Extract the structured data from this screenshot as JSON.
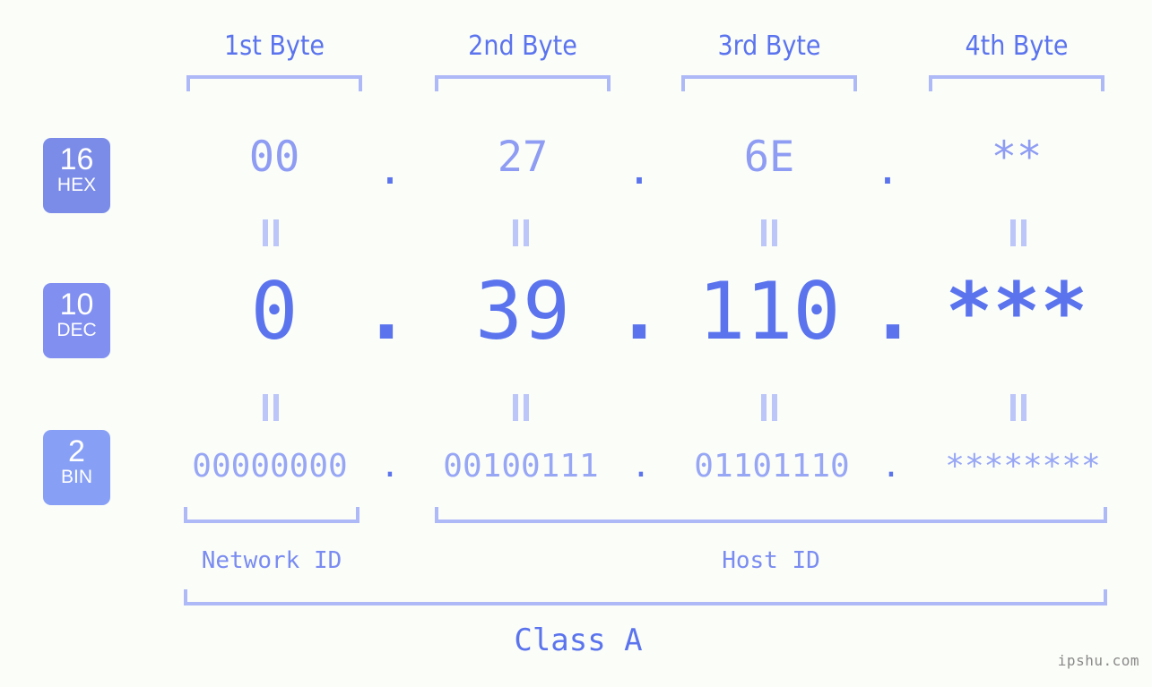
{
  "colors": {
    "background": "#fbfdf8",
    "accent_strong": "#5b74ee",
    "accent_mid": "#8e9cf3",
    "accent_light": "#aeb9f7",
    "badge_hex": "#7b8ce8",
    "badge_dec": "#808ff0",
    "badge_bin": "#87a0f5",
    "watermark": "#8a8a8a"
  },
  "headers": [
    {
      "label": "1st Byte"
    },
    {
      "label": "2nd Byte"
    },
    {
      "label": "3rd Byte"
    },
    {
      "label": "4th Byte"
    }
  ],
  "bases": [
    {
      "num": "16",
      "name": "HEX"
    },
    {
      "num": "10",
      "name": "DEC"
    },
    {
      "num": "2",
      "name": "BIN"
    }
  ],
  "rows": {
    "hex": {
      "values": [
        "00",
        "27",
        "6E",
        "**"
      ],
      "separators": [
        ".",
        ".",
        "."
      ]
    },
    "dec": {
      "values": [
        "0",
        "39",
        "110",
        "***"
      ],
      "separators": [
        ".",
        ".",
        "."
      ]
    },
    "bin": {
      "values": [
        "00000000",
        "00100111",
        "01101110",
        "********"
      ],
      "separators": [
        ".",
        ".",
        "."
      ]
    }
  },
  "equals_symbol": "=",
  "regions": [
    {
      "label": "Network ID"
    },
    {
      "label": "Host ID"
    }
  ],
  "class": {
    "label": "Class A"
  },
  "watermark": {
    "text": "ipshu.com"
  }
}
